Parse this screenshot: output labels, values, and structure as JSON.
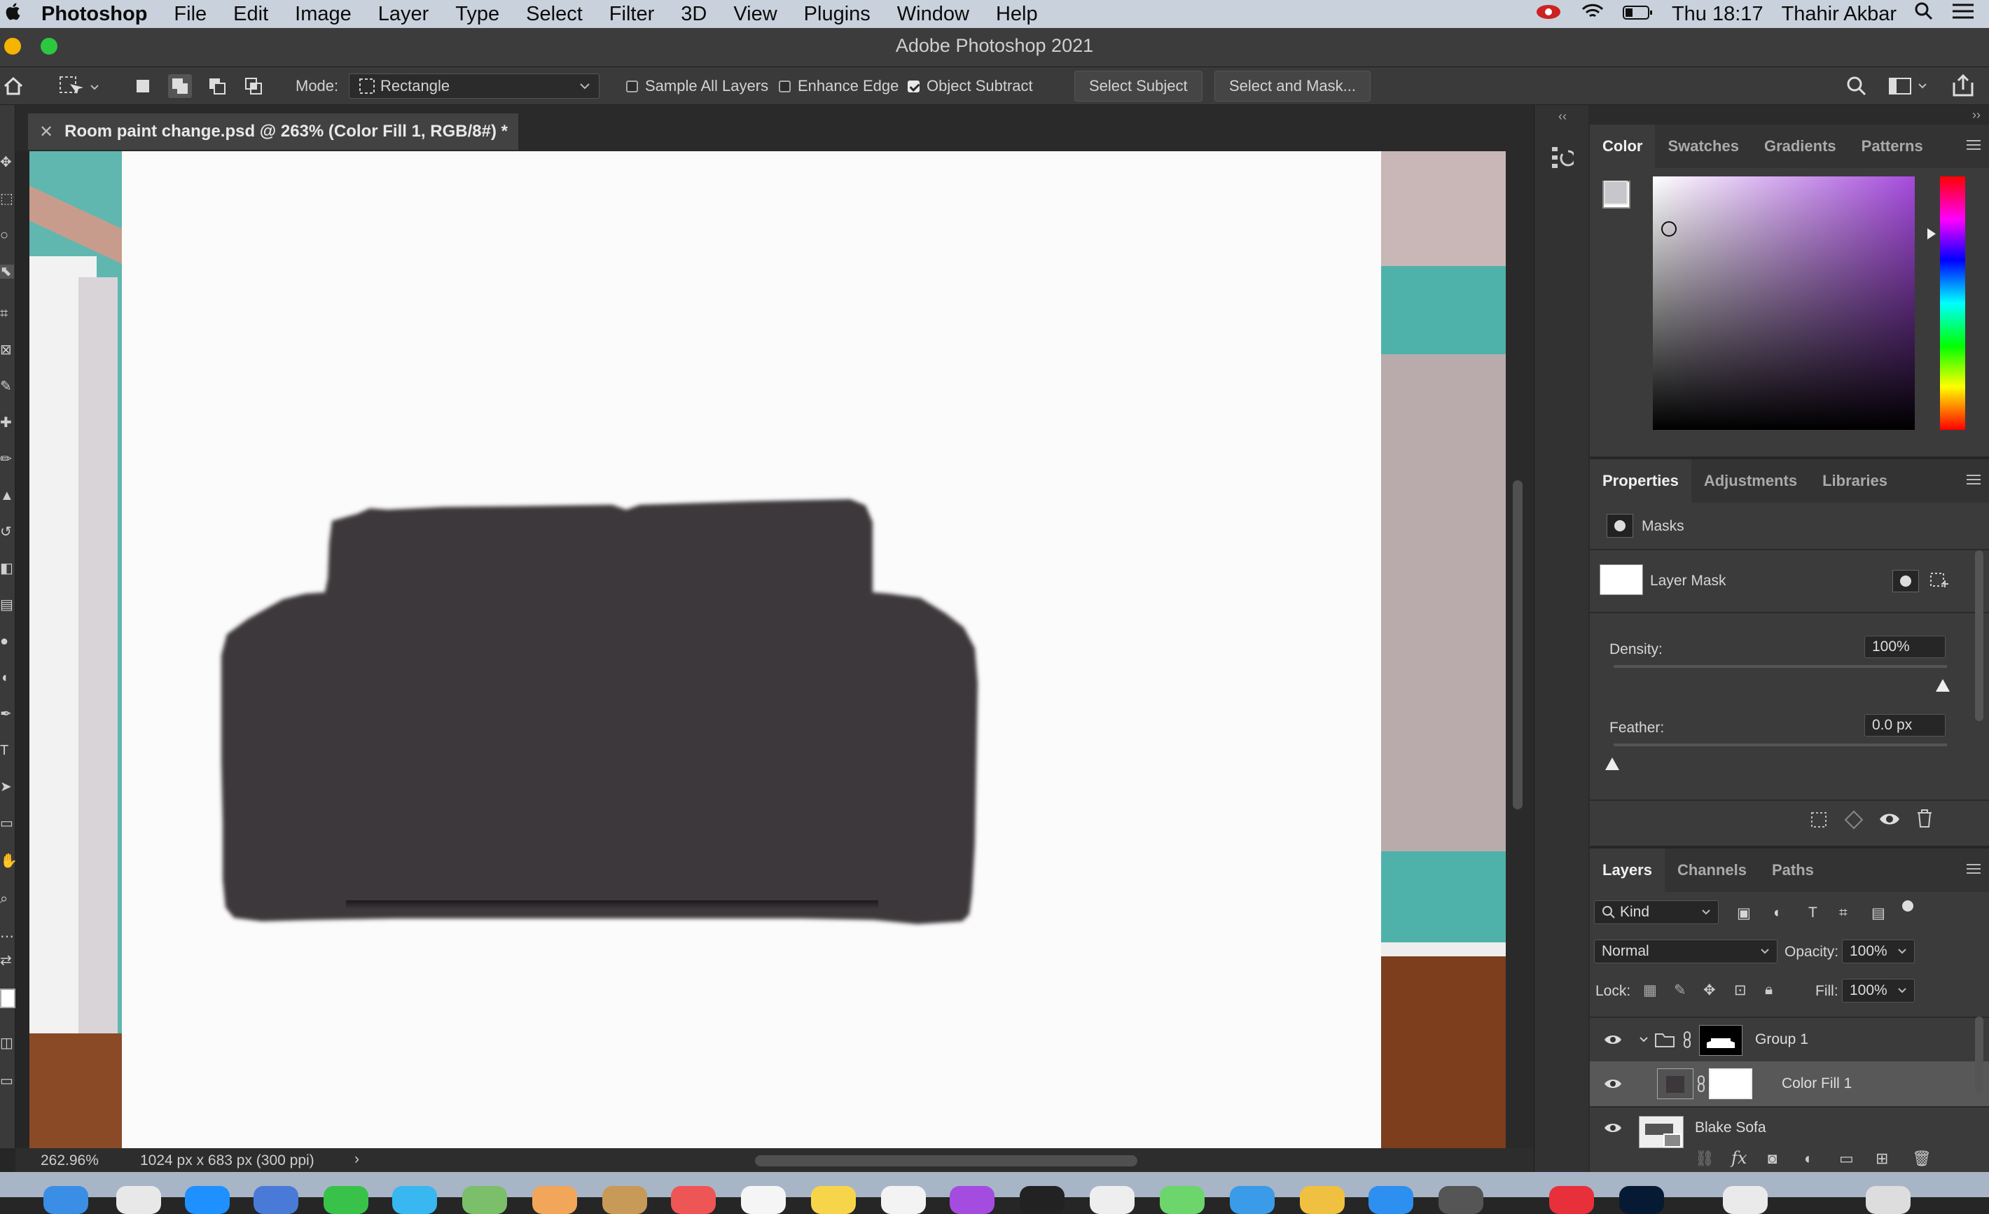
{
  "menubar": {
    "app": "Photoshop",
    "items": [
      "File",
      "Edit",
      "Image",
      "Layer",
      "Type",
      "Select",
      "Filter",
      "3D",
      "View",
      "Plugins",
      "Window",
      "Help"
    ],
    "clock": "Thu 18:17",
    "user": "Thahir Akbar"
  },
  "window": {
    "title": "Adobe Photoshop 2021"
  },
  "options": {
    "mode_label": "Mode:",
    "mode_value": "Rectangle",
    "sample_all_layers": "Sample All Layers",
    "enhance_edge": "Enhance Edge",
    "object_subtract": "Object Subtract",
    "select_subject": "Select Subject",
    "select_and_mask": "Select and Mask..."
  },
  "document": {
    "tab_title": "Room paint change.psd @ 263% (Color Fill 1, RGB/8#) *",
    "zoom": "262.96%",
    "info": "1024 px x 683 px (300 ppi)",
    "sofa_color": "#3c373a"
  },
  "color_panel": {
    "tabs": [
      "Color",
      "Swatches",
      "Gradients",
      "Patterns"
    ],
    "active": "Color"
  },
  "properties": {
    "tabs": [
      "Properties",
      "Adjustments",
      "Libraries"
    ],
    "active": "Properties",
    "section": "Masks",
    "mask_label": "Layer Mask",
    "density_label": "Density:",
    "density_value": "100%",
    "feather_label": "Feather:",
    "feather_value": "0.0 px"
  },
  "layers": {
    "tabs": [
      "Layers",
      "Channels",
      "Paths"
    ],
    "active": "Layers",
    "filter": "Kind",
    "blend": "Normal",
    "opacity_label": "Opacity:",
    "opacity": "100%",
    "lock_label": "Lock:",
    "fill_label": "Fill:",
    "fill": "100%",
    "items": [
      {
        "name": "Group 1"
      },
      {
        "name": "Color Fill 1"
      },
      {
        "name": "Blake Sofa"
      }
    ]
  },
  "colors": {
    "accent": "#a54bdd",
    "panel_bg": "#3b3b3b"
  }
}
